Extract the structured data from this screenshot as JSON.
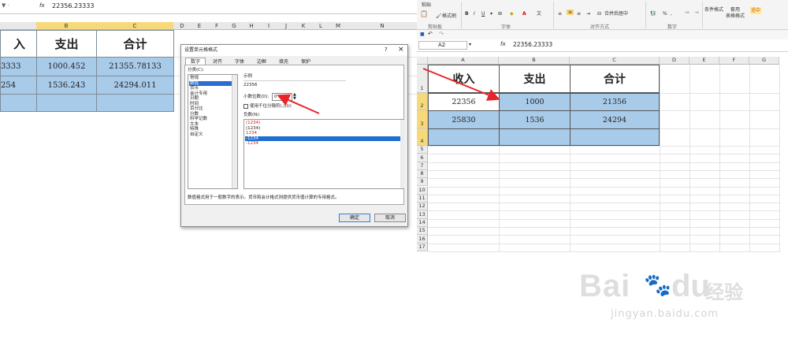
{
  "left_sheet": {
    "formula_value": "22356.23333",
    "fx_label": "fx",
    "col_headers": [
      "B",
      "C",
      "D",
      "E",
      "F",
      "G",
      "H",
      "I",
      "J",
      "K",
      "L",
      "M",
      "N"
    ],
    "header_row": [
      "入",
      "支出",
      "合计"
    ],
    "rows": [
      [
        "3333",
        "1000.452",
        "21355.78133"
      ],
      [
        "254",
        "1536.243",
        "24294.011"
      ]
    ]
  },
  "dialog": {
    "title": "设置单元格格式",
    "help": "?",
    "close": "×",
    "tabs": [
      "数字",
      "对齐",
      "字体",
      "边框",
      "填充",
      "保护"
    ],
    "category_label": "分类(C):",
    "categories": [
      "常规",
      "数值",
      "货币",
      "会计专用",
      "日期",
      "时间",
      "百分比",
      "分数",
      "科学记数",
      "文本",
      "特殊",
      "自定义"
    ],
    "selected_category": 1,
    "sample_label": "示例",
    "sample_value": "22356",
    "decimal_label": "小数位数(D):",
    "decimal_value": "0",
    "thousands_label": "使用千位分隔符(,)(U)",
    "negative_label": "负数(N):",
    "negatives": [
      "(1234)",
      "(1234)",
      "1234",
      "-1234",
      "-1234"
    ],
    "negative_colors": [
      "#d02020",
      "#222222",
      "#d02020",
      "#ffffff",
      "#d02020"
    ],
    "selected_negative": 3,
    "description": "数值格式用于一般数字的表示。货币和会计格式则提供货币值计算的专用格式。",
    "ok_label": "确定",
    "cancel_label": "取消"
  },
  "ribbon": {
    "paste": "粘贴",
    "format_painter": "格式刷",
    "merge": "合并后居中",
    "percent": "%",
    "comma": ",",
    "conditional": "条件格式",
    "apply": "套用",
    "table_format": "表格格式",
    "apply_extra": "适中",
    "sections": [
      "剪贴板",
      "字体",
      "对齐方式",
      "数字"
    ]
  },
  "right_sheet": {
    "name_box": "A2",
    "fx_label": "fx",
    "formula_value": "22356.23333",
    "col_headers": [
      "A",
      "B",
      "C",
      "D",
      "E",
      "F",
      "G"
    ],
    "row_headers": [
      "1",
      "2",
      "3",
      "4",
      "5",
      "6",
      "7",
      "8",
      "9",
      "10",
      "11",
      "12",
      "13",
      "14",
      "15",
      "16",
      "17"
    ],
    "header_row": [
      "收入",
      "支出",
      "合计"
    ],
    "rows": [
      [
        "22356",
        "1000",
        "21356"
      ],
      [
        "25830",
        "1536",
        "24294"
      ]
    ]
  },
  "watermark": {
    "brand": "Bai",
    "brand2": "du",
    "cn": "经验",
    "url": "jingyan.baidu.com",
    "color": "#d9d9d9"
  }
}
